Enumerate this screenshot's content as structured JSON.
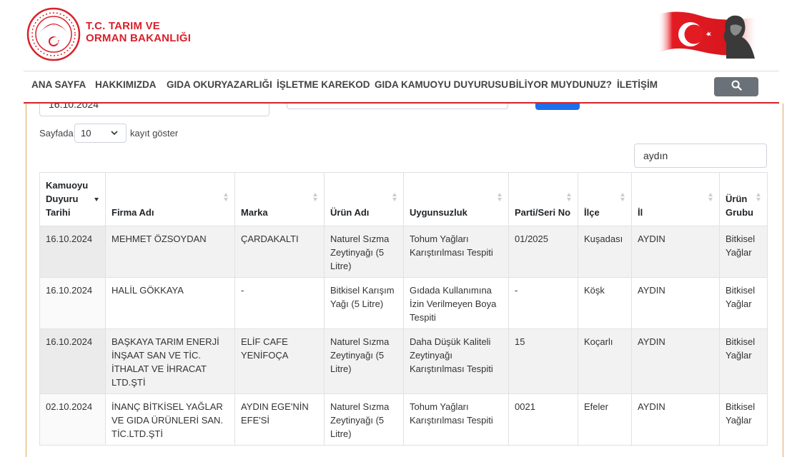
{
  "header": {
    "logo_line1": "T.C. TARIM VE",
    "logo_line2": "ORMAN BAKANLIĞI",
    "colors": {
      "brand_red": "#d9202a",
      "nav_gray": "#444444",
      "search_btn": "#6b7178"
    }
  },
  "nav": {
    "items": [
      {
        "label": "ANA SAYFA"
      },
      {
        "label": "HAKKIMIZDA"
      },
      {
        "label": "GIDA OKURYAZARLIĞI"
      },
      {
        "label": "İŞLETME KAREKOD"
      },
      {
        "label": "GIDA KAMUOYU DUYURUSU"
      },
      {
        "label": "BİLİYOR MUYDUNUZ?"
      },
      {
        "label": "İLETİŞİM"
      }
    ],
    "search_icon": "search-icon"
  },
  "filters": {
    "date_value": "16.10.2024"
  },
  "table_controls": {
    "length_prefix": "Sayfada",
    "length_value": "10",
    "length_suffix": "kayıt göster",
    "search_value": "aydın"
  },
  "table": {
    "columns": [
      {
        "label": "Kamuoyu Duyuru Tarihi",
        "sort": "desc"
      },
      {
        "label": "Firma Adı",
        "sort": "none"
      },
      {
        "label": "Marka",
        "sort": "none"
      },
      {
        "label": "Ürün Adı",
        "sort": "none"
      },
      {
        "label": "Uygunsuzluk",
        "sort": "none"
      },
      {
        "label": "Parti/Seri No",
        "sort": "none"
      },
      {
        "label": "İlçe",
        "sort": "none"
      },
      {
        "label": "İl",
        "sort": "none"
      },
      {
        "label": "Ürün Grubu",
        "sort": "none"
      }
    ],
    "rows": [
      [
        "16.10.2024",
        "MEHMET ÖZSOYDAN",
        "ÇARDAKALTI",
        "Naturel Sızma Zeytinyağı (5 Litre)",
        "Tohum Yağları Karıştırılması Tespiti",
        "01/2025",
        "Kuşadası",
        "AYDIN",
        "Bitkisel Yağlar"
      ],
      [
        "16.10.2024",
        "HALİL GÖKKAYA",
        "-",
        "Bitkisel Karışım Yağı (5 Litre)",
        "Gıdada Kullanımına İzin Verilmeyen Boya Tespiti",
        "-",
        "Köşk",
        "AYDIN",
        "Bitkisel Yağlar"
      ],
      [
        "16.10.2024",
        "BAŞKAYA TARIM ENERJİ İNŞAAT SAN VE TİC. İTHALAT VE İHRACAT LTD.ŞTİ",
        "ELİF CAFE YENİFOÇA",
        "Naturel Sızma Zeytinyağı (5 Litre)",
        "Daha Düşük Kaliteli Zeytinyağı Karıştırılması Tespiti",
        "15",
        "Koçarlı",
        "AYDIN",
        "Bitkisel Yağlar"
      ],
      [
        "02.10.2024",
        "İNANÇ BİTKİSEL YAĞLAR VE GIDA ÜRÜNLERİ SAN. TİC.LTD.ŞTİ",
        "AYDIN EGE'NİN EFE'Sİ",
        "Naturel Sızma Zeytinyağı (5 Litre)",
        "Tohum Yağları Karıştırılması Tespiti",
        "0021",
        "Efeler",
        "AYDIN",
        "Bitkisel Yağlar"
      ]
    ]
  }
}
